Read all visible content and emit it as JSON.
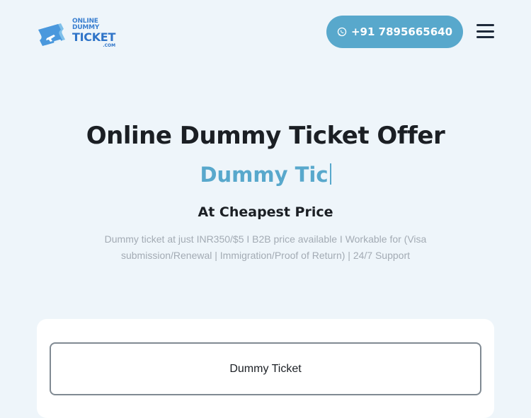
{
  "header": {
    "logo": {
      "line1": "ONLINE DUMMY",
      "line2": "TICKET",
      "line3": ".COM"
    },
    "phone_label": "+91 7895665640",
    "phone_icon": "whatsapp-icon",
    "menu_icon": "hamburger-menu-icon"
  },
  "hero": {
    "title": "Online Dummy Ticket Offer",
    "typed_text": "Dummy Tic",
    "subtitle": "At Cheapest Price",
    "description": "Dummy ticket at just INR350/$5 I B2B price available I Workable for (Visa submission/Renewal | Immigration/Proof of Return) | 24/7 Support"
  },
  "card": {
    "option_label": "Dummy Ticket"
  },
  "colors": {
    "accent": "#58a8cc",
    "background": "#eef5fa",
    "text": "#1b1f24",
    "muted": "#a3abb4"
  }
}
